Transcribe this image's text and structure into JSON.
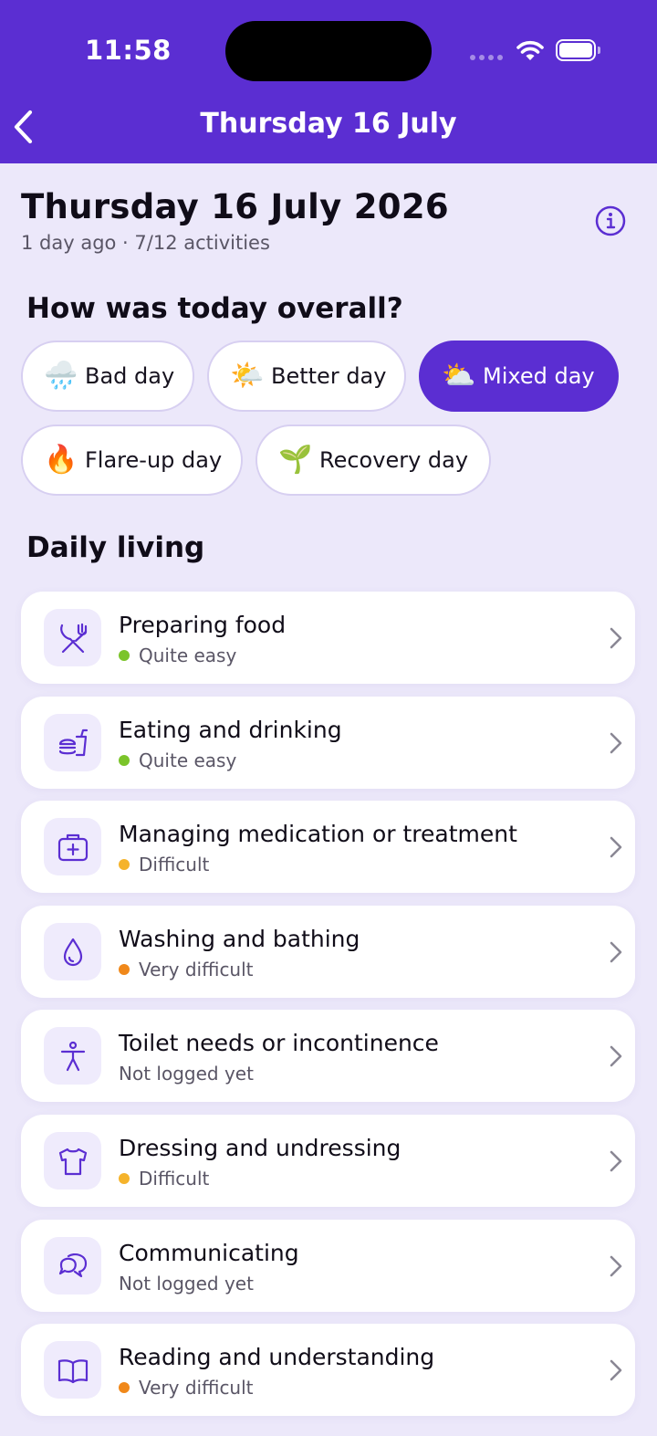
{
  "status_bar": {
    "time": "11:58"
  },
  "nav": {
    "title": "Thursday 16 July"
  },
  "day": {
    "title": "Thursday 16 July 2026",
    "subtitle": "1 day ago · 7/12 activities"
  },
  "overall": {
    "heading": "How was today overall?",
    "options": [
      {
        "label": "Bad day",
        "emoji": "🌧️",
        "icon": "rain-cloud-icon",
        "selected": false
      },
      {
        "label": "Better day",
        "emoji": "🌤️",
        "icon": "sun-behind-cloud-icon",
        "selected": false
      },
      {
        "label": "Mixed day",
        "emoji": "⛅",
        "icon": "partly-cloudy-icon",
        "selected": true
      },
      {
        "label": "Flare-up day",
        "emoji": "🔥",
        "icon": "fire-icon",
        "selected": false
      },
      {
        "label": "Recovery day",
        "emoji": "🌱",
        "icon": "seedling-icon",
        "selected": false
      }
    ]
  },
  "daily_living": {
    "heading": "Daily living",
    "items": [
      {
        "title": "Preparing food",
        "status": "Quite easy",
        "status_color": "#7BC42A",
        "icon": "utensils-icon"
      },
      {
        "title": "Eating and drinking",
        "status": "Quite easy",
        "status_color": "#7BC42A",
        "icon": "food-drink-icon"
      },
      {
        "title": "Managing medication or treatment",
        "status": "Difficult",
        "status_color": "#F5B32B",
        "icon": "medical-kit-icon"
      },
      {
        "title": "Washing and bathing",
        "status": "Very difficult",
        "status_color": "#F0881A",
        "icon": "water-drop-icon"
      },
      {
        "title": "Toilet needs or incontinence",
        "status": "Not logged yet",
        "status_color": "",
        "icon": "accessibility-icon"
      },
      {
        "title": "Dressing and undressing",
        "status": "Difficult",
        "status_color": "#F5B32B",
        "icon": "shirt-icon"
      },
      {
        "title": "Communicating",
        "status": "Not logged yet",
        "status_color": "",
        "icon": "chat-bubbles-icon"
      },
      {
        "title": "Reading and understanding",
        "status": "Very difficult",
        "status_color": "#F0881A",
        "icon": "book-icon"
      }
    ]
  },
  "colors": {
    "brand": "#5B2ED2",
    "background": "#ECE8FA",
    "icon_tile": "#EFEBFC"
  }
}
